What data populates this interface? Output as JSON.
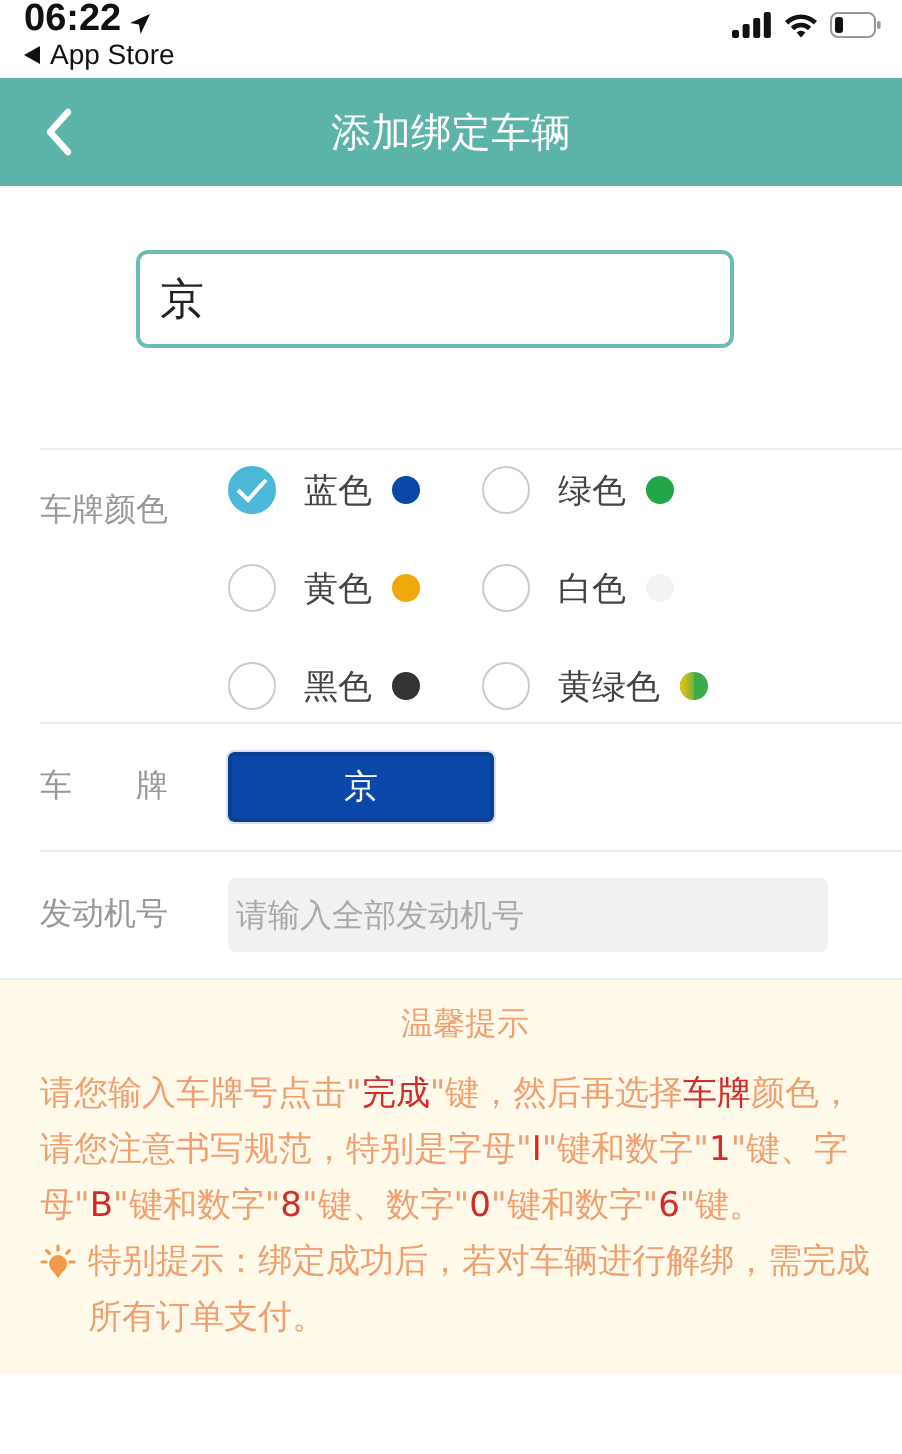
{
  "status_bar": {
    "time": "06:22",
    "back_app": "App Store"
  },
  "header": {
    "title": "添加绑定车辆"
  },
  "plate_input": {
    "value": "京"
  },
  "plate_color": {
    "label": "车牌颜色",
    "options": [
      {
        "label": "蓝色",
        "selected": true,
        "color": "#0b47a8",
        "kind": "solid"
      },
      {
        "label": "绿色",
        "selected": false,
        "color": "#21a64a",
        "kind": "solid"
      },
      {
        "label": "黄色",
        "selected": false,
        "color": "#efa90c",
        "kind": "solid"
      },
      {
        "label": "白色",
        "selected": false,
        "color": "#f2f2f2",
        "kind": "solid"
      },
      {
        "label": "黑色",
        "selected": false,
        "color": "#333333",
        "kind": "solid"
      },
      {
        "label": "黄绿色",
        "selected": false,
        "color": "#3daa48",
        "kind": "gradient"
      }
    ]
  },
  "plate": {
    "label": "车　　牌",
    "value": "京",
    "color": "#0b47a8"
  },
  "engine": {
    "label": "发动机号",
    "placeholder": "请输入全部发动机号"
  },
  "tips": {
    "title": "温馨提示",
    "body": "请您输入车牌号点击\"**完成**\"键，然后再选择**车牌**颜色，请您注意书写规范，特别是字母\"**I**\"键和数字\"**1**\"键、字母\"**B**\"键和数字\"**8**\"键、数字\"**0**\"键和数字\"**6**\"键。",
    "special": "特别提示：绑定成功后，若对车辆进行解绑，需完成所有订单支付。"
  }
}
